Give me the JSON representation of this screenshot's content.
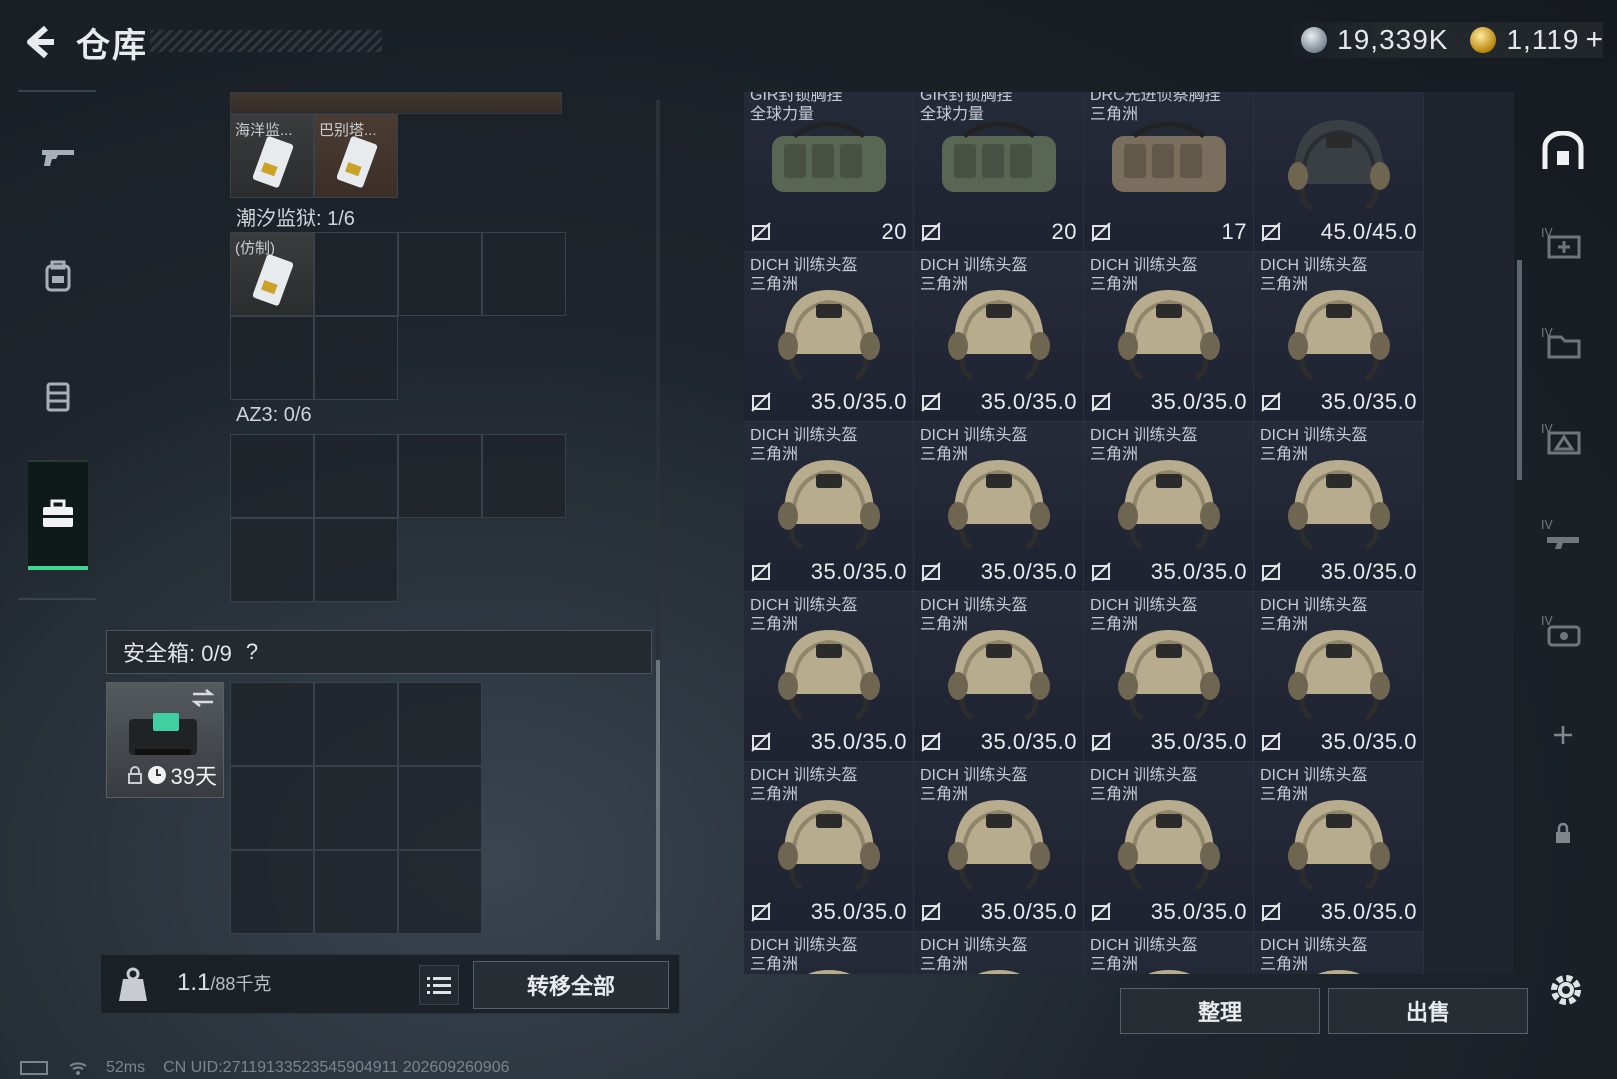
{
  "header": {
    "title": "仓库",
    "currency_silver": "19,339K",
    "currency_gold": "1,119",
    "plus": "+"
  },
  "rail": {
    "items": [
      "weapons",
      "armor",
      "bags",
      "case"
    ]
  },
  "containers": {
    "top_cells": [
      {
        "label": "海洋监..."
      },
      {
        "label": "巴别塔..."
      }
    ],
    "tide_prison": {
      "label": "潮汐监狱: 1/6",
      "cells": [
        {
          "label": "(仿制)"
        }
      ]
    },
    "az3": {
      "label": "AZ3: 0/6"
    },
    "safe_box": {
      "label": "安全箱: 0/9",
      "help": "?",
      "days": "39天"
    }
  },
  "bottom_left": {
    "weight": "1.1",
    "weight_unit": "/88千克",
    "transfer_all": "转移全部"
  },
  "stash": {
    "items": [
      {
        "name": "GIR封锁胸挂\n全球力量",
        "value": "20",
        "kind": "bag",
        "color": "#5a6654"
      },
      {
        "name": "GIR封锁胸挂\n全球力量",
        "value": "20",
        "kind": "bag",
        "color": "#5a6654"
      },
      {
        "name": "DRC先进侦察胸挂\n三角洲",
        "value": "17",
        "kind": "bag",
        "color": "#7a6e5c"
      },
      {
        "name": "",
        "value": "45.0/45.0",
        "kind": "helmet-dark"
      },
      {
        "name": "DICH 训练头盔\n三角洲",
        "value": "35.0/35.0",
        "kind": "helmet"
      }
    ],
    "helmet_name": "DICH 训练头盔\n三角洲",
    "helmet_dur": "35.0/35.0"
  },
  "bottom_right": {
    "sort": "整理",
    "sell": "出售"
  },
  "footer": {
    "ping": "52ms",
    "uid": "CN UID:27119133523545904911 202609260906"
  }
}
